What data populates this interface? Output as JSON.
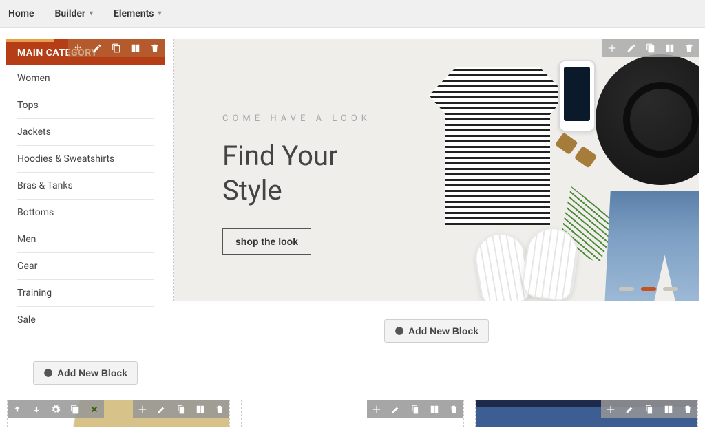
{
  "nav": {
    "home": "Home",
    "builder": "Builder",
    "elements": "Elements"
  },
  "sidebar": {
    "heading": "MAIN CATEGORY",
    "items": [
      "Women",
      "Tops",
      "Jackets",
      "Hoodies & Sweatshirts",
      "Bras & Tanks",
      "Bottoms",
      "Men",
      "Gear",
      "Training",
      "Sale"
    ]
  },
  "hero": {
    "eyebrow": "COME HAVE A LOOK",
    "title_line1": "Find Your",
    "title_line2": "Style",
    "cta": "shop the look",
    "active_slide": 1,
    "slide_count": 3
  },
  "buttons": {
    "add_block": "Add New Block"
  },
  "toolbar_icons": [
    "move",
    "edit",
    "duplicate",
    "columns",
    "delete"
  ],
  "left_toolbar_icons": [
    "up",
    "down",
    "settings",
    "duplicate",
    "close"
  ]
}
